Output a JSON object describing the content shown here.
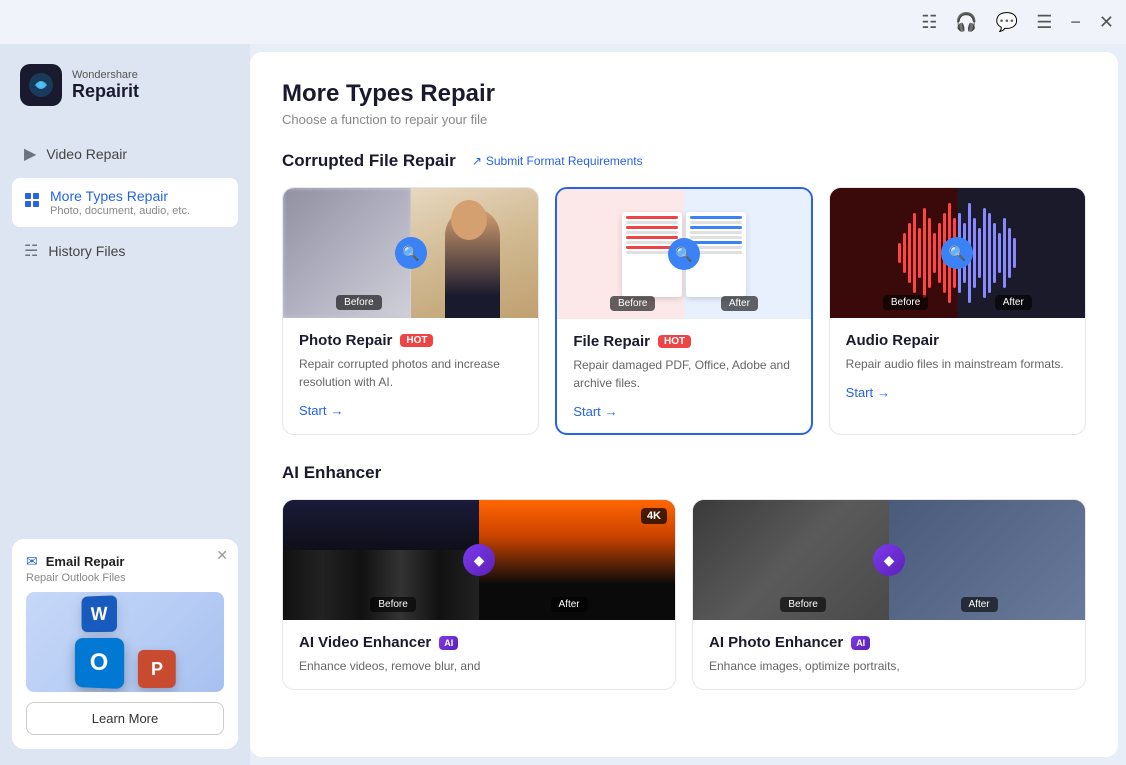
{
  "titleBar": {
    "icons": [
      "account-icon",
      "headset-icon",
      "chat-icon",
      "menu-icon",
      "minimize-icon",
      "close-icon"
    ]
  },
  "sidebar": {
    "logo": {
      "brand": "Wondershare",
      "name": "Repairit"
    },
    "navItems": [
      {
        "id": "video-repair",
        "label": "Video Repair",
        "active": false
      },
      {
        "id": "more-types-repair",
        "label": "More Types Repair",
        "sub": "Photo, document, audio, etc.",
        "active": true
      },
      {
        "id": "history-files",
        "label": "History Files",
        "active": false
      }
    ],
    "emailCard": {
      "title": "Email Repair",
      "sub": "Repair Outlook Files",
      "learnMore": "Learn More"
    }
  },
  "main": {
    "title": "More Types Repair",
    "subtitle": "Choose a function to repair your file",
    "sections": {
      "corruptedFileRepair": {
        "title": "Corrupted File Repair",
        "submitLink": "Submit Format Requirements",
        "cards": [
          {
            "id": "photo-repair",
            "title": "Photo Repair",
            "badge": "HOT",
            "description": "Repair corrupted photos and increase resolution with AI.",
            "start": "Start",
            "selected": false
          },
          {
            "id": "file-repair",
            "title": "File Repair",
            "badge": "HOT",
            "description": "Repair damaged PDF, Office, Adobe and archive files.",
            "start": "Start",
            "selected": true
          },
          {
            "id": "audio-repair",
            "title": "Audio Repair",
            "badge": null,
            "description": "Repair audio files in mainstream formats.",
            "start": "Start",
            "selected": false
          }
        ]
      },
      "aiEnhancer": {
        "title": "AI Enhancer",
        "cards": [
          {
            "id": "ai-video-enhancer",
            "title": "AI Video Enhancer",
            "badge": "AI",
            "badge4k": "4K",
            "description": "Enhance videos, remove blur, and"
          },
          {
            "id": "ai-photo-enhancer",
            "title": "AI Photo Enhancer",
            "badge": "AI",
            "description": "Enhance images, optimize portraits,"
          }
        ]
      }
    }
  }
}
